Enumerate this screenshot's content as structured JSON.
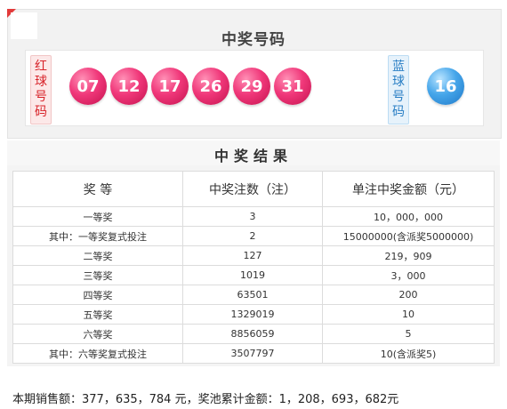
{
  "header": {
    "title": "中奖号码"
  },
  "red": {
    "label": "红球号码",
    "balls": [
      "07",
      "12",
      "17",
      "26",
      "29",
      "31"
    ]
  },
  "blue": {
    "label": "蓝球号码",
    "balls": [
      "16"
    ]
  },
  "results": {
    "title": "中奖结果",
    "columns": [
      "奖 等",
      "中奖注数（注）",
      "单注中奖金额（元）"
    ],
    "rows": [
      [
        "一等奖",
        "3",
        "10，000，000"
      ],
      [
        "其中：一等奖复式投注",
        "2",
        "15000000(含派奖5000000)"
      ],
      [
        "二等奖",
        "127",
        "219，909"
      ],
      [
        "三等奖",
        "1019",
        "3，000"
      ],
      [
        "四等奖",
        "63501",
        "200"
      ],
      [
        "五等奖",
        "1329019",
        "10"
      ],
      [
        "六等奖",
        "8856059",
        "5"
      ],
      [
        "其中：六等奖复式投注",
        "3507797",
        "10(含派奖5)"
      ]
    ]
  },
  "footer": {
    "text": "本期销售额：377，635，784 元，奖池累计金额：1，208，693，682元"
  },
  "colors": {
    "accent": "#d8232a",
    "red_ball": "#f0387a",
    "blue_ball": "#46a6ea"
  }
}
